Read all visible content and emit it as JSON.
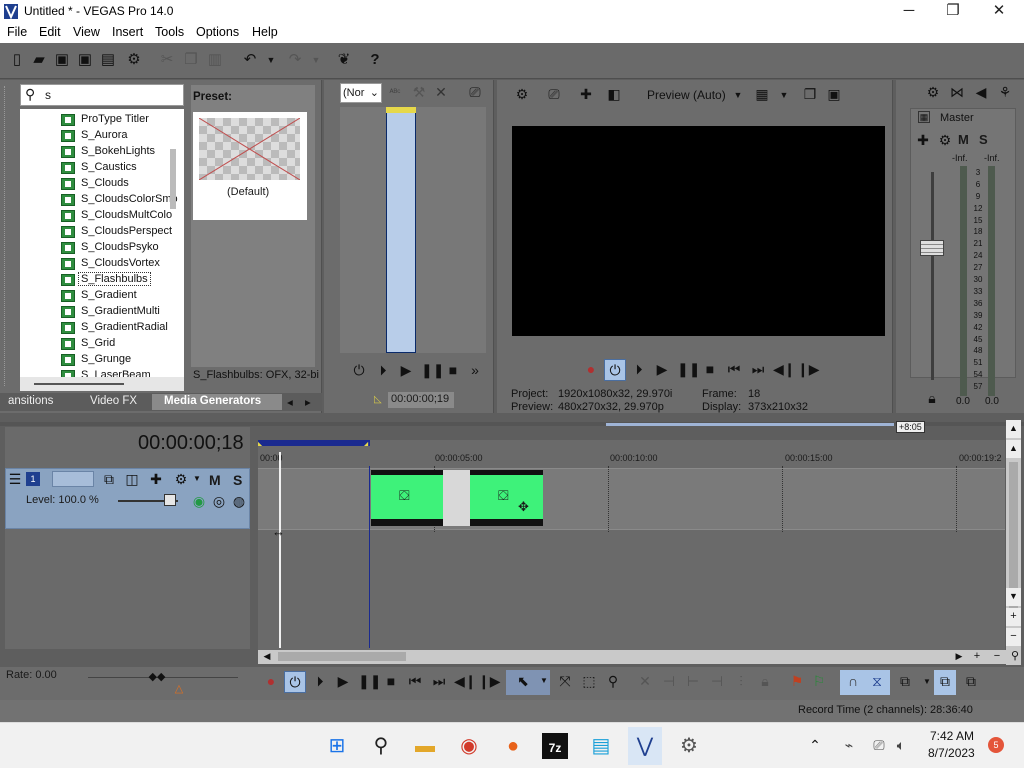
{
  "window": {
    "title": "Untitled * - VEGAS Pro 14.0",
    "minimize": "─",
    "maximize": "❐",
    "close": "✕"
  },
  "menu": [
    "File",
    "Edit",
    "View",
    "Insert",
    "Tools",
    "Options",
    "Help"
  ],
  "explorer": {
    "search_value": "s",
    "items": [
      "ProType Titler",
      "S_Aurora",
      "S_BokehLights",
      "S_Caustics",
      "S_Clouds",
      "S_CloudsColorSmo",
      "S_CloudsMultColo",
      "S_CloudsPerspect",
      "S_CloudsPsyko",
      "S_CloudsVortex",
      "S_Flashbulbs",
      "S_Gradient",
      "S_GradientMulti",
      "S_GradientRadial",
      "S_Grid",
      "S_Grunge",
      "S_LaserBeam"
    ],
    "selected": "S_Flashbulbs",
    "preset_header": "Preset:",
    "preset_name": "(Default)",
    "status": "S_Flashbulbs: OFX, 32-bi",
    "tabs": [
      "ansitions",
      "Video FX",
      "Media Generators"
    ]
  },
  "trimmer": {
    "dropdown": "(Nor",
    "timecode": "00:00:00;19"
  },
  "preview": {
    "mode": "Preview (Auto)",
    "project_label": "Project:",
    "project_value": "1920x1080x32, 29.970i",
    "preview_label": "Preview:",
    "preview_value": "480x270x32, 29.970p",
    "frame_label": "Frame:",
    "frame_value": "18",
    "display_label": "Display:",
    "display_value": "373x210x32"
  },
  "mixer": {
    "master": "Master",
    "m": "M",
    "s": "S",
    "inf_left": "-Inf.",
    "inf_right": "-Inf.",
    "scale": [
      "3",
      "6",
      "9",
      "12",
      "15",
      "18",
      "21",
      "24",
      "27",
      "30",
      "33",
      "36",
      "39",
      "42",
      "45",
      "48",
      "51",
      "54",
      "57"
    ],
    "bottom_left": "0.0",
    "bottom_right": "0.0"
  },
  "timeline": {
    "timecode": "00:00:00;18",
    "offset_badge": "+8:05",
    "ruler": [
      "00:00",
      "00:00:05:00",
      "00:00:10:00",
      "00:00:15:00",
      "00:00:19:2"
    ],
    "track_number": "1",
    "track_m": "M",
    "track_s": "S",
    "level": "Level: 100.0 %",
    "rate": "Rate: 0.00"
  },
  "status": {
    "record_time": "Record Time (2 channels): 28:36:40"
  },
  "taskbar": {
    "time": "7:42 AM",
    "date": "8/7/2023",
    "badge": "5"
  }
}
